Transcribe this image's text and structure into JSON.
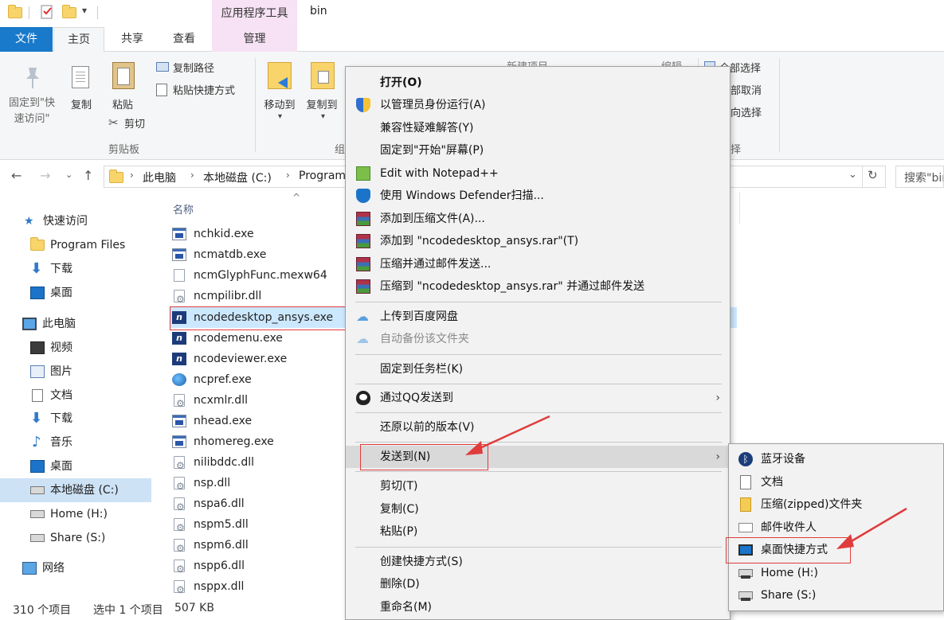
{
  "titlebar": {
    "contextual_tab_title": "应用程序工具",
    "window_title": "bin"
  },
  "tabs": {
    "file": "文件",
    "home": "主页",
    "share": "共享",
    "view": "查看",
    "manage": "管理"
  },
  "ribbon": {
    "pin_quick_access": "固定到\"快\n速访问\"",
    "pin_line1": "固定到\"快",
    "pin_line2": "速访问\"",
    "copy": "复制",
    "paste": "粘贴",
    "copy_path": "复制路径",
    "paste_shortcut": "粘贴快捷方式",
    "cut": "剪切",
    "clipboard_group": "剪贴板",
    "move_to": "移动到",
    "copy_to": "复制到",
    "organize_group_partial": "组",
    "new_item_partial": "新建项目",
    "edit_partial": "编辑",
    "select_all_partial": "全部选择",
    "select_none_partial": "部取消",
    "invert_selection_partial": "向选择",
    "select_group_partial": "择"
  },
  "address": {
    "crumbs": [
      "此电脑",
      "本地磁盘 (C:)",
      "Program"
    ],
    "search_placeholder": "搜索\"bin\""
  },
  "sidebar": {
    "items": [
      {
        "label": "快速访问",
        "icon": "star-icon"
      },
      {
        "label": "Program Files",
        "icon": "folder-icon"
      },
      {
        "label": "下载",
        "icon": "download-icon"
      },
      {
        "label": "桌面",
        "icon": "desktop-icon"
      },
      {
        "label": "此电脑",
        "icon": "computer-icon"
      },
      {
        "label": "视频",
        "icon": "video-icon"
      },
      {
        "label": "图片",
        "icon": "pictures-icon"
      },
      {
        "label": "文档",
        "icon": "documents-icon"
      },
      {
        "label": "下载",
        "icon": "download-icon"
      },
      {
        "label": "音乐",
        "icon": "music-icon"
      },
      {
        "label": "桌面",
        "icon": "desktop-icon"
      },
      {
        "label": "本地磁盘 (C:)",
        "icon": "local-disk-icon"
      },
      {
        "label": "Home (H:)",
        "icon": "network-drive-icon"
      },
      {
        "label": "Share (S:)",
        "icon": "network-drive-icon"
      },
      {
        "label": "网络",
        "icon": "network-icon"
      }
    ]
  },
  "filelist": {
    "column_name": "名称",
    "files": [
      {
        "name": "nchkid.exe",
        "type": "exe"
      },
      {
        "name": "ncmatdb.exe",
        "type": "exe"
      },
      {
        "name": "ncmGlyphFunc.mexw64",
        "type": "blank"
      },
      {
        "name": "ncmpilibr.dll",
        "type": "dll"
      },
      {
        "name": "ncodedesktop_ansys.exe",
        "type": "ncode"
      },
      {
        "name": "ncodemenu.exe",
        "type": "ncode"
      },
      {
        "name": "ncodeviewer.exe",
        "type": "ncode"
      },
      {
        "name": "ncpref.exe",
        "type": "globe"
      },
      {
        "name": "ncxmlr.dll",
        "type": "dll"
      },
      {
        "name": "nhead.exe",
        "type": "exe"
      },
      {
        "name": "nhomereg.exe",
        "type": "exe"
      },
      {
        "name": "nilibddc.dll",
        "type": "dll"
      },
      {
        "name": "nsp.dll",
        "type": "dll"
      },
      {
        "name": "nspa6.dll",
        "type": "dll"
      },
      {
        "name": "nspm5.dll",
        "type": "dll"
      },
      {
        "name": "nspm6.dll",
        "type": "dll"
      },
      {
        "name": "nspp6.dll",
        "type": "dll"
      },
      {
        "name": "nsppx.dll",
        "type": "dll"
      }
    ]
  },
  "statusbar": {
    "item_count": "310 个项目",
    "selected": "选中 1 个项目",
    "size": "507 KB"
  },
  "context_menu": {
    "items": [
      {
        "label": "打开(O)",
        "bold": true
      },
      {
        "label": "以管理员身份运行(A)",
        "icon": "uac-shield-icon"
      },
      {
        "label": "兼容性疑难解答(Y)"
      },
      {
        "label": "固定到\"开始\"屏幕(P)"
      },
      {
        "label": "Edit with Notepad++",
        "icon": "notepad-plus-plus-icon"
      },
      {
        "label": "使用 Windows Defender扫描...",
        "icon": "windows-defender-icon"
      },
      {
        "label": "添加到压缩文件(A)...",
        "icon": "winrar-icon"
      },
      {
        "label": "添加到 \"ncodedesktop_ansys.rar\"(T)",
        "icon": "winrar-icon"
      },
      {
        "label": "压缩并通过邮件发送...",
        "icon": "winrar-icon"
      },
      {
        "label": "压缩到 \"ncodedesktop_ansys.rar\" 并通过邮件发送",
        "icon": "winrar-icon"
      },
      {
        "label": "上传到百度网盘",
        "icon": "baidu-cloud-icon"
      },
      {
        "label": "自动备份该文件夹",
        "icon": "baidu-cloud-icon",
        "disabled": true
      },
      {
        "label": "固定到任务栏(K)"
      },
      {
        "label": "通过QQ发送到",
        "icon": "qq-icon",
        "submenu": true
      },
      {
        "label": "还原以前的版本(V)"
      },
      {
        "label": "发送到(N)",
        "submenu": true,
        "highlighted": true
      },
      {
        "label": "剪切(T)"
      },
      {
        "label": "复制(C)"
      },
      {
        "label": "粘贴(P)"
      },
      {
        "label": "创建快捷方式(S)"
      },
      {
        "label": "删除(D)"
      },
      {
        "label": "重命名(M)"
      }
    ]
  },
  "send_to_submenu": {
    "items": [
      {
        "label": "蓝牙设备",
        "icon": "bluetooth-icon"
      },
      {
        "label": "文档",
        "icon": "documents-icon"
      },
      {
        "label": "压缩(zipped)文件夹",
        "icon": "zip-folder-icon"
      },
      {
        "label": "邮件收件人",
        "icon": "mail-icon"
      },
      {
        "label": "桌面快捷方式",
        "icon": "desktop-icon"
      },
      {
        "label": "Home (H:)",
        "icon": "network-drive-icon"
      },
      {
        "label": "Share (S:)",
        "icon": "network-drive-icon"
      }
    ]
  },
  "colors": {
    "file_tab": "#1979ca",
    "contextual_tab": "#f6e2f4",
    "selection": "#cce8ff",
    "annotation_red": "#e03c3c"
  }
}
